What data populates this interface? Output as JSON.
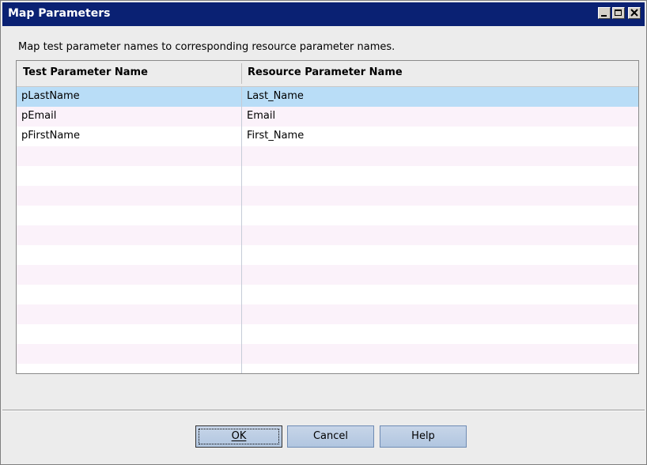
{
  "window": {
    "title": "Map Parameters",
    "controls": {
      "minimize_icon": "minimize-icon",
      "maximize_icon": "maximize-icon",
      "close_icon": "close-icon"
    }
  },
  "instruction": "Map test parameter names to corresponding resource parameter names.",
  "table": {
    "columns": [
      "Test Parameter Name",
      "Resource Parameter Name"
    ],
    "rows": [
      {
        "test": "pLastName",
        "resource": "Last_Name",
        "selected": true
      },
      {
        "test": "pEmail",
        "resource": "Email",
        "selected": false
      },
      {
        "test": "pFirstName",
        "resource": "First_Name",
        "selected": false
      }
    ]
  },
  "buttons": {
    "ok": "OK",
    "cancel": "Cancel",
    "help": "Help"
  },
  "colors": {
    "titlebar": "#0a2173",
    "selected_row": "#b9ddf7",
    "alt_row": "#fbf2fa",
    "button": "#b1c6e0"
  }
}
